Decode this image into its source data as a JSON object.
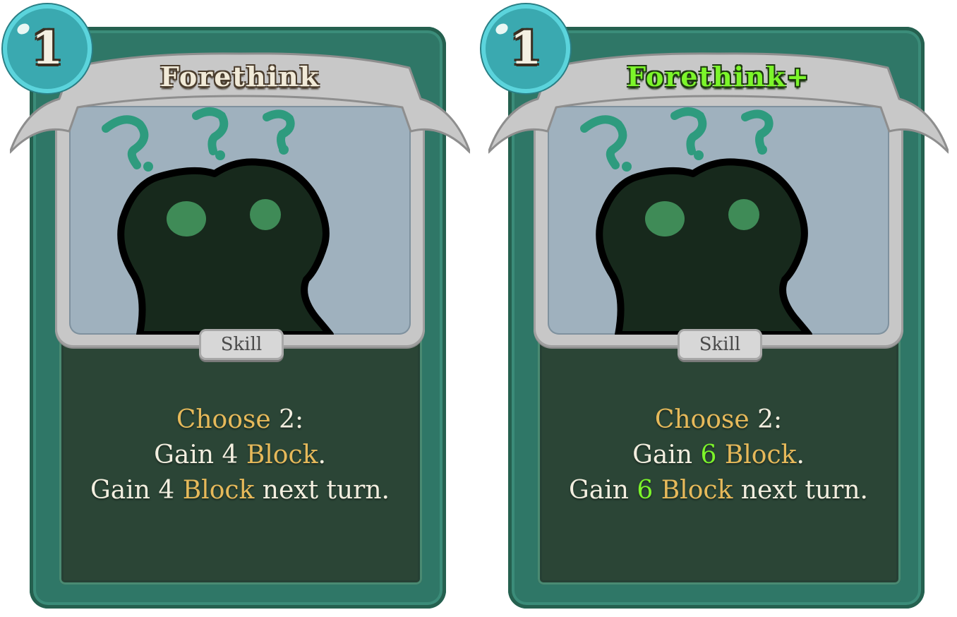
{
  "cards": [
    {
      "cost": "1",
      "title": "Forethink",
      "type": "Skill",
      "upgraded": false,
      "description": {
        "line1_keyword": "Choose",
        "line1_value": "2",
        "line1_suffix": ":",
        "line2_prefix": "Gain ",
        "line2_value": "4",
        "line2_keyword": " Block",
        "line2_suffix": ".",
        "line3_prefix": "Gain ",
        "line3_value": "4",
        "line3_keyword": " Block",
        "line3_suffix": " next turn."
      }
    },
    {
      "cost": "1",
      "title": "Forethink+",
      "type": "Skill",
      "upgraded": true,
      "description": {
        "line1_keyword": "Choose",
        "line1_value": "2",
        "line1_suffix": ":",
        "line2_prefix": "Gain ",
        "line2_value": "6",
        "line2_keyword": " Block",
        "line2_suffix": ".",
        "line3_prefix": "Gain ",
        "line3_value": "6",
        "line3_keyword": " Block",
        "line3_suffix": " next turn."
      }
    }
  ],
  "colors": {
    "card_frame": "#2f7767",
    "keyword": "#e6b95a",
    "upgrade": "#7cf52a",
    "energy_orb": "#3aa9b0"
  },
  "icons": [
    "energy-orb-icon",
    "question-mark-icon",
    "creature-silhouette-icon"
  ]
}
